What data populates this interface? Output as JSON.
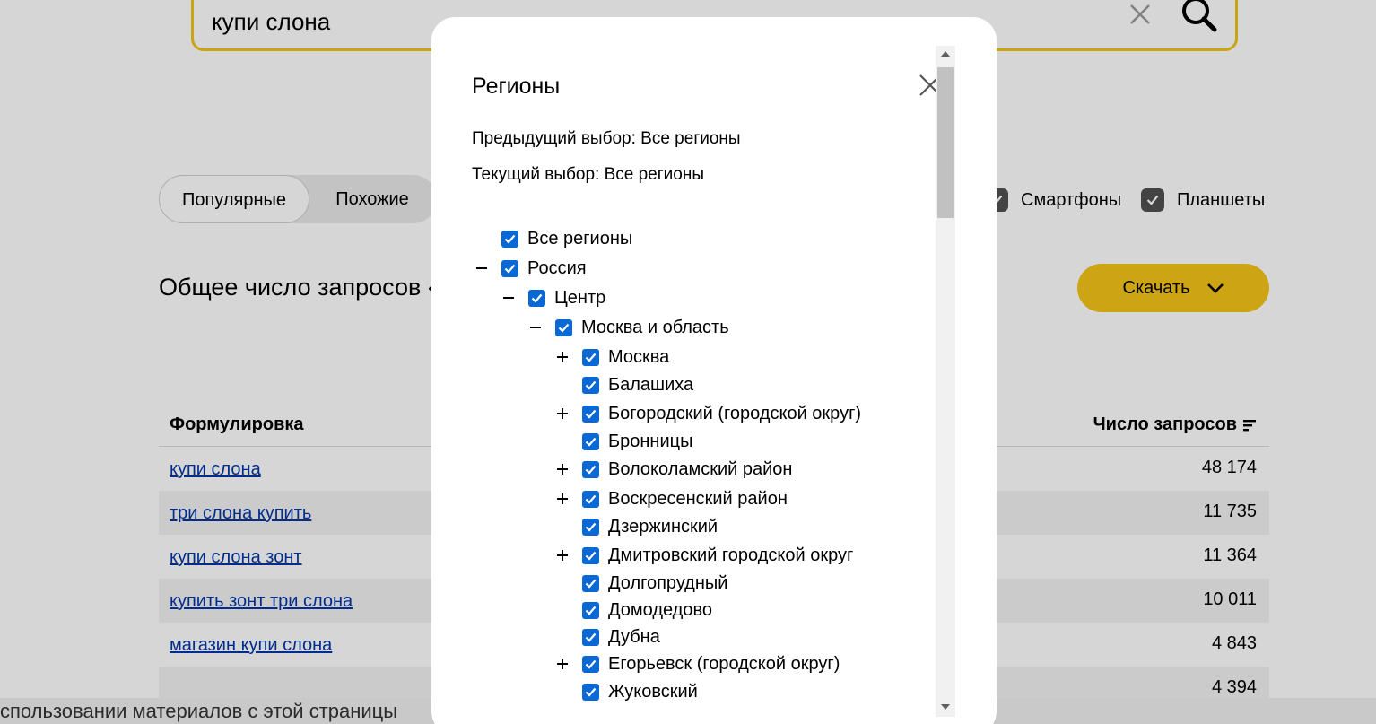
{
  "search": {
    "query": "купи слона"
  },
  "tabs": [
    {
      "label": "Популярные",
      "active": true
    },
    {
      "label": "Похожие",
      "active": false
    }
  ],
  "devices": [
    {
      "label": "Смартфоны",
      "checked": true
    },
    {
      "label": "Планшеты",
      "checked": true
    }
  ],
  "total_heading": "Общее число запросов «",
  "download_label": "Скачать",
  "table": {
    "col_phrase": "Формулировка",
    "col_count": "Число запросов",
    "rows": [
      {
        "phrase": "купи слона",
        "count": "48 174"
      },
      {
        "phrase": "три слона купить",
        "count": "11 735"
      },
      {
        "phrase": "купи слона зонт",
        "count": "11 364"
      },
      {
        "phrase": "купить зонт три слона",
        "count": "10 011"
      },
      {
        "phrase": "магазин купи слона",
        "count": "4 843"
      },
      {
        "phrase": "",
        "count": "4 394"
      }
    ]
  },
  "footer_note": "спользовании материалов с этой страницы",
  "modal": {
    "title": "Регионы",
    "previous_choice": "Предыдущий выбор: Все регионы",
    "current_choice": "Текущий выбор: Все регионы",
    "tree": [
      {
        "label": "Все регионы",
        "level": 0,
        "toggle": "none"
      },
      {
        "label": "Россия",
        "level": 0,
        "toggle": "minus"
      },
      {
        "label": "Центр",
        "level": 1,
        "toggle": "minus"
      },
      {
        "label": "Москва и область",
        "level": 2,
        "toggle": "minus"
      },
      {
        "label": "Москва",
        "level": 3,
        "toggle": "plus"
      },
      {
        "label": "Балашиха",
        "level": 3,
        "toggle": "none"
      },
      {
        "label": "Богородский (городской округ)",
        "level": 3,
        "toggle": "plus"
      },
      {
        "label": "Бронницы",
        "level": 3,
        "toggle": "none"
      },
      {
        "label": "Волоколамский район",
        "level": 3,
        "toggle": "plus"
      },
      {
        "label": "Воскресенский район",
        "level": 3,
        "toggle": "plus"
      },
      {
        "label": "Дзержинский",
        "level": 3,
        "toggle": "none"
      },
      {
        "label": "Дмитровский городской округ",
        "level": 3,
        "toggle": "plus"
      },
      {
        "label": "Долгопрудный",
        "level": 3,
        "toggle": "none"
      },
      {
        "label": "Домодедово",
        "level": 3,
        "toggle": "none"
      },
      {
        "label": "Дубна",
        "level": 3,
        "toggle": "none"
      },
      {
        "label": "Егорьевск (городской округ)",
        "level": 3,
        "toggle": "plus"
      },
      {
        "label": "Жуковский",
        "level": 3,
        "toggle": "none"
      }
    ]
  },
  "colors": {
    "accent": "#f3c419",
    "checkbox": "#0a68d4",
    "link": "#0036a8"
  }
}
